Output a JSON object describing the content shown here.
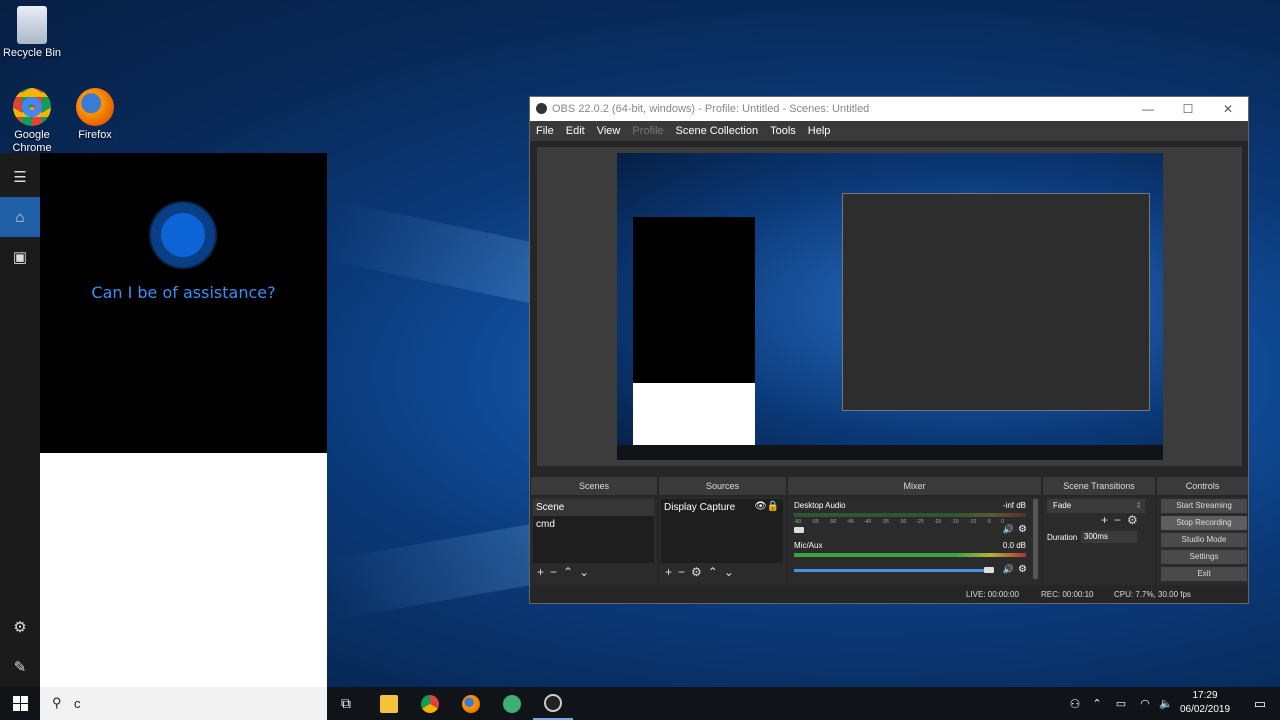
{
  "desktop": {
    "icons": [
      {
        "label": "Recycle Bin",
        "icon": "recycle-bin-icon"
      },
      {
        "label": "Google Chrome",
        "icon": "chrome-icon"
      },
      {
        "label": "Firefox",
        "icon": "firefox-icon"
      }
    ]
  },
  "cortana": {
    "question": "Can I be of assistance?",
    "search_value": "c",
    "rail_icons": [
      "hamburger-icon",
      "home-icon",
      "notebook-icon",
      "settings-icon",
      "feedback-icon"
    ]
  },
  "obs": {
    "title": "OBS 22.0.2 (64-bit, windows) - Profile: Untitled - Scenes: Untitled",
    "menu": [
      "File",
      "Edit",
      "View",
      "Profile",
      "Scene Collection",
      "Tools",
      "Help"
    ],
    "docks": {
      "scenes_title": "Scenes",
      "sources_title": "Sources",
      "mixer_title": "Mixer",
      "transitions_title": "Scene Transitions",
      "controls_title": "Controls"
    },
    "scenes": [
      "Scene",
      "cmd"
    ],
    "sources": [
      "Display Capture"
    ],
    "mixer": [
      {
        "name": "Desktop Audio",
        "level": "-inf dB"
      },
      {
        "name": "Mic/Aux",
        "level": "0.0 dB"
      }
    ],
    "mixer_ticks": [
      "-60",
      "-55",
      "-50",
      "-45",
      "-40",
      "-35",
      "-30",
      "-25",
      "-20",
      "-15",
      "-10",
      "-5",
      "0"
    ],
    "transition": {
      "value": "Fade",
      "duration_label": "Duration",
      "duration_value": "300ms"
    },
    "controls": [
      "Start Streaming",
      "Stop Recording",
      "Studio Mode",
      "Settings",
      "Exit"
    ],
    "status": {
      "live": "LIVE: 00:00:00",
      "rec": "REC: 00:00:10",
      "cpu": "CPU: 7.7%, 30.00 fps"
    }
  },
  "taskbar": {
    "clock_time": "17:29",
    "clock_date": "06/02/2019",
    "apps": [
      "task-view-icon",
      "file-explorer-icon",
      "chrome-icon",
      "firefox-icon",
      "app-icon",
      "obs-icon"
    ]
  }
}
